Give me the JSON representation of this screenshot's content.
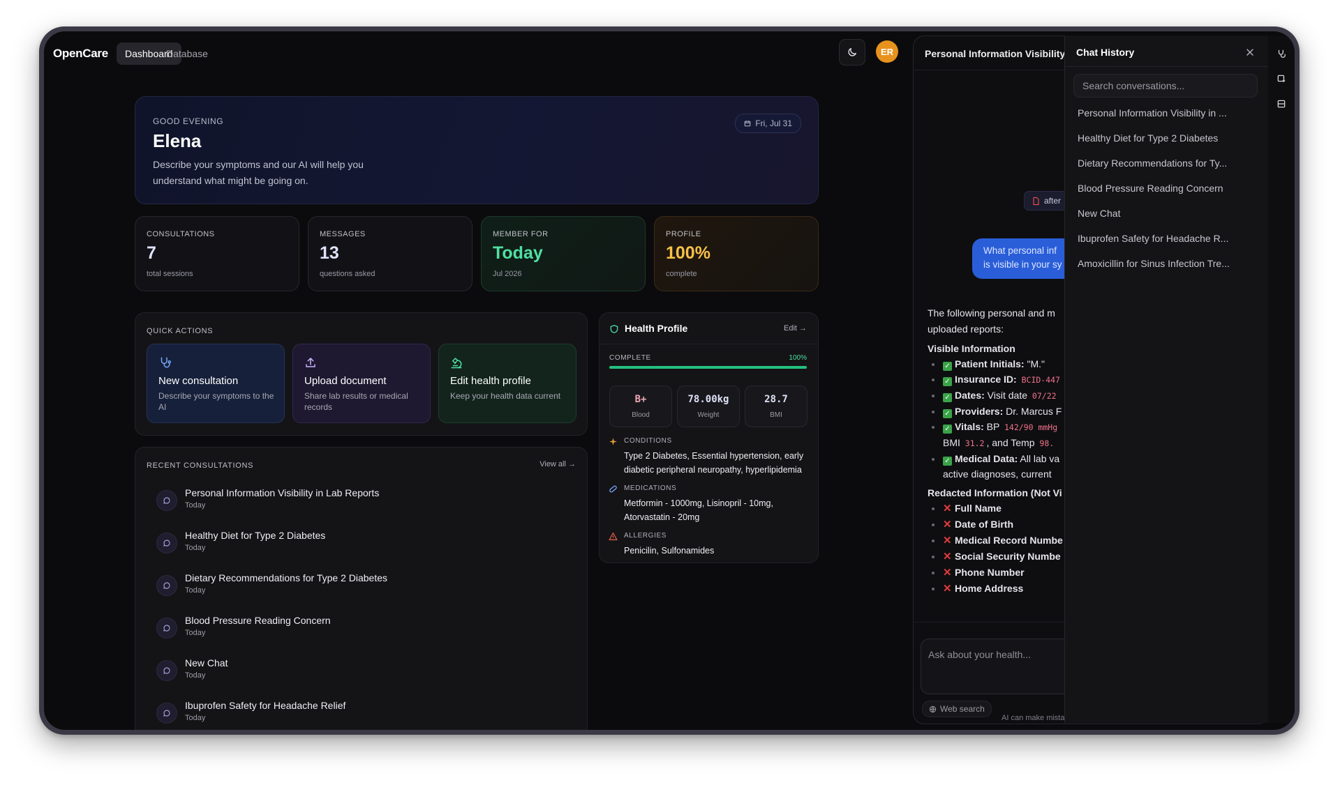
{
  "nav": {
    "brand": "OpenCare",
    "tabs": [
      {
        "label": "Dashboard"
      },
      {
        "label": "Database"
      }
    ],
    "avatar_initials": "ER"
  },
  "greeting": {
    "label": "GOOD EVENING",
    "name": "Elena",
    "description": "Describe your symptoms and our AI will help you understand what might be going on.",
    "date": "Fri, Jul 31"
  },
  "stats": [
    {
      "label": "CONSULTATIONS",
      "value": "7",
      "sub": "total sessions"
    },
    {
      "label": "MESSAGES",
      "value": "13",
      "sub": "questions asked"
    },
    {
      "label": "MEMBER FOR",
      "value": "Today",
      "sub": "Jul 2026"
    },
    {
      "label": "PROFILE",
      "value": "100%",
      "sub": "complete"
    }
  ],
  "quick_actions": {
    "label": "QUICK ACTIONS",
    "items": [
      {
        "title": "New consultation",
        "desc": "Describe your symptoms to the AI",
        "icon": "stethoscope-icon"
      },
      {
        "title": "Upload document",
        "desc": "Share lab results or medical records",
        "icon": "upload-icon"
      },
      {
        "title": "Edit health profile",
        "desc": "Keep your health data current",
        "icon": "microscope-icon"
      }
    ]
  },
  "recent": {
    "label": "RECENT CONSULTATIONS",
    "view_all": "View all →",
    "items": [
      {
        "title": "Personal Information Visibility in Lab Reports",
        "date": "Today"
      },
      {
        "title": "Healthy Diet for Type 2 Diabetes",
        "date": "Today"
      },
      {
        "title": "Dietary Recommendations for Type 2 Diabetes",
        "date": "Today"
      },
      {
        "title": "Blood Pressure Reading Concern",
        "date": "Today"
      },
      {
        "title": "New Chat",
        "date": "Today"
      },
      {
        "title": "Ibuprofen Safety for Headache Relief",
        "date": "Today"
      }
    ]
  },
  "health_profile": {
    "title": "Health Profile",
    "edit": "Edit →",
    "complete_label": "COMPLETE",
    "complete_value": "100%",
    "complete_fraction": 1.0,
    "metrics": [
      {
        "value": "B+",
        "label": "Blood"
      },
      {
        "value": "78.00kg",
        "label": "Weight"
      },
      {
        "value": "28.7",
        "label": "BMI"
      }
    ],
    "conditions": {
      "label": "CONDITIONS",
      "value": "Type 2 Diabetes, Essential hypertension, early diabetic peripheral neuropathy, hyperlipidemia"
    },
    "medications": {
      "label": "MEDICATIONS",
      "value": "Metformin - 1000mg, Lisinopril - 10mg, Atorvastatin - 20mg"
    },
    "allergies": {
      "label": "ALLERGIES",
      "value": "Penicilin, Sulfonamides"
    }
  },
  "chat": {
    "title": "Personal Information Visibility",
    "attachment": "after",
    "user_message": [
      "What personal inf",
      "is visible in your sy"
    ],
    "answer": {
      "intro": [
        "The following personal and m",
        "uploaded reports:"
      ],
      "visible_heading": "Visible Information",
      "visible": [
        {
          "key": "Patient Initials:",
          "text": " \"M.\""
        },
        {
          "key": "Insurance ID:",
          "code": "BCID-447"
        },
        {
          "key": "Dates:",
          "text": " Visit date ",
          "code": "07/22"
        },
        {
          "key": "Providers:",
          "text": " Dr. Marcus F"
        },
        {
          "key": "Vitals:",
          "text": " BP ",
          "code": "142/90 mmHg",
          "line2_a": "BMI ",
          "code2": "31.2",
          "line2_b": ", and Temp ",
          "code3": "98."
        },
        {
          "key": "Medical Data:",
          "text": " All lab va",
          "line2_a": "active diagnoses, current"
        }
      ],
      "redacted_heading": "Redacted Information (Not Vi",
      "redacted": [
        "Full Name",
        "Date of Birth",
        "Medical Record Numbe",
        "Social Security Numbe",
        "Phone Number",
        "Home Address"
      ]
    },
    "input_placeholder": "Ask about your health...",
    "web_search": "Web search",
    "disclaimer": "AI can make mista"
  },
  "history": {
    "title": "Chat History",
    "search_placeholder": "Search conversations...",
    "items": [
      "Personal Information Visibility in ...",
      "Healthy Diet for Type 2 Diabetes",
      "Dietary Recommendations for Ty...",
      "Blood Pressure Reading Concern",
      "New Chat",
      "Ibuprofen Safety for Headache R...",
      "Amoxicillin for Sinus Infection Tre..."
    ]
  },
  "colors": {
    "accent_blue": "#2a5ed8",
    "green": "#4fe0a2",
    "orange": "#f8c048",
    "avatar": "#e8921e"
  }
}
